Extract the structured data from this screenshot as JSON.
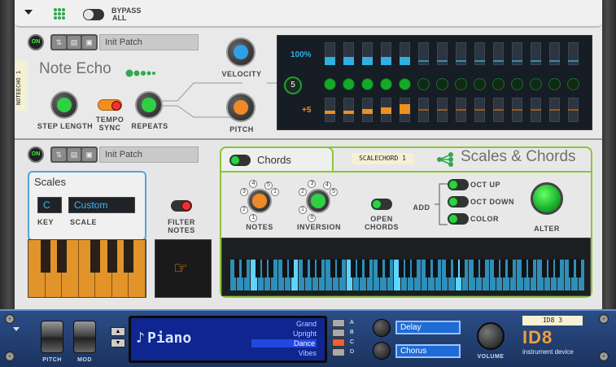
{
  "rack": {
    "bypass_label": "BYPASS",
    "bypass_all_label": "ALL",
    "bypass_state": "off"
  },
  "note_echo": {
    "on_label": "ON",
    "patch_name": "Init Patch",
    "title": "Note Echo",
    "tape_label": "NOTEECHO 1",
    "knobs": {
      "step_length": "STEP LENGTH",
      "tempo_sync": "TEMPO SYNC",
      "repeats": "REPEATS",
      "velocity": "VELOCITY",
      "pitch": "PITCH"
    },
    "seq": {
      "velocity_label": "100%",
      "pitch_label": "+5",
      "repeats_value": "5",
      "active_steps": 5,
      "total_steps": 14
    },
    "colors": {
      "accent_green": "#16a82a",
      "velocity_teal": "#2fb0e0",
      "pitch_orange": "#f09020"
    }
  },
  "scales_chords": {
    "on_label": "ON",
    "patch_name": "Init Patch",
    "tape_label": "SCALECHORD 1",
    "title": "Scales & Chords",
    "scales_header": "Scales",
    "key_value": "C",
    "scale_value": "Custom",
    "key_label": "KEY",
    "scale_label": "SCALE",
    "filter_notes_label": "FILTER NOTES",
    "chords_label": "Chords",
    "notes_label": "NOTES",
    "inversion_label": "INVERSION",
    "open_chords_label": "OPEN CHORDS",
    "add_label": "ADD",
    "oct_up_label": "OCT UP",
    "oct_down_label": "OCT DOWN",
    "color_label": "COLOR",
    "alter_label": "ALTER",
    "notes_ticks": [
      "1",
      "2",
      "3",
      "4",
      "5",
      "1"
    ],
    "inversion_ticks": [
      "0",
      "1",
      "2",
      "3",
      "4",
      "5"
    ]
  },
  "id8": {
    "pitch_label": "PITCH",
    "mod_label": "MOD",
    "patch_name": "Piano",
    "patch_list": [
      "Grand",
      "Upright",
      "Dance",
      "Vibes"
    ],
    "selected_index": 2,
    "slot_letters": [
      "A",
      "B",
      "C",
      "D"
    ],
    "fx1": "Delay",
    "fx2": "Chorus",
    "volume_label": "VOLUME",
    "tape_label": "ID8 3",
    "brand": "ID8",
    "subtitle": "instrument device"
  }
}
